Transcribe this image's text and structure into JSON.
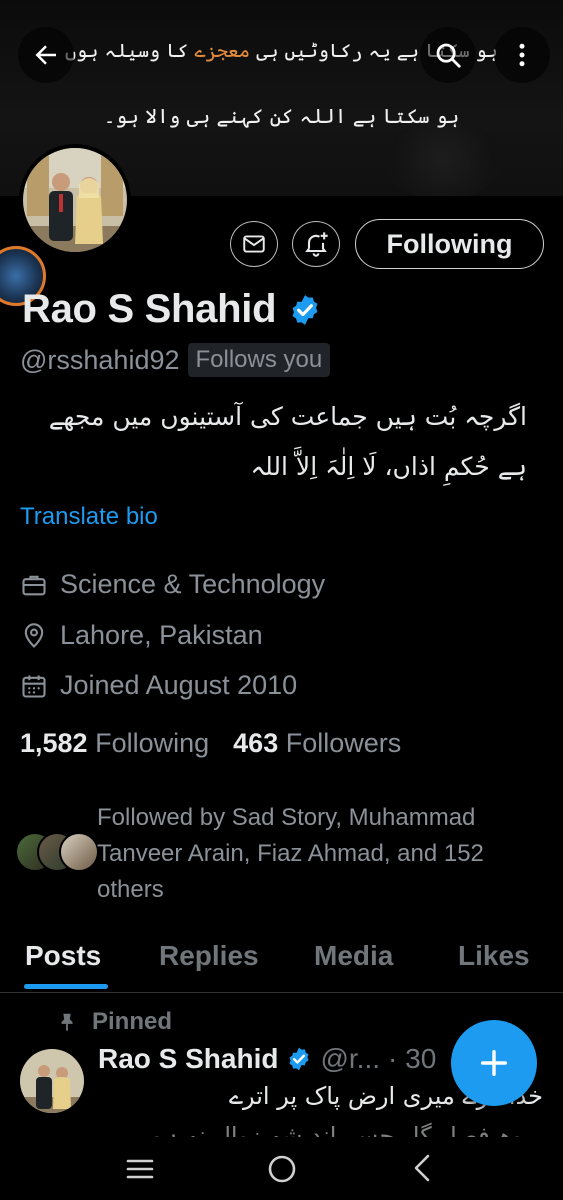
{
  "banner": {
    "line1_part1": "ہو سکتا ہے یہ رکاوٹیں ہی",
    "line1_highlight": "معجزے",
    "line1_part2": "کا وسیلہ ہوں",
    "line2": "ہو سکتا ہے اللہ کن کہنے ہی والا ہو۔"
  },
  "icons": {
    "back": "arrow-left-icon",
    "search": "search-icon",
    "more": "more-vertical-icon",
    "message": "envelope-icon",
    "notify": "bell-plus-icon",
    "verified": "verified-badge-icon",
    "category": "briefcase-icon",
    "location": "location-pin-icon",
    "joined": "calendar-icon",
    "pin": "pin-icon",
    "compose": "plus-icon"
  },
  "colors": {
    "accent": "#1d9bf0",
    "banner_highlight": "#e08a3c",
    "background": "#000000",
    "muted_text": "#8b9198"
  },
  "profile": {
    "follow_button": "Following",
    "name": "Rao S Shahid",
    "handle": "@rsshahid92",
    "follows_you": "Follows you",
    "bio_line1": "اگرچہ بُت ہیں جماعت کی آستینوں میں مجھے",
    "bio_line2": "ہے حُکمِ اذاں، لَا اِلٰہَ اِلاَّ اللہ",
    "translate_bio": "Translate bio",
    "category": "Science & Technology",
    "location": "Lahore, Pakistan",
    "joined": "Joined August 2010",
    "following_count": "1,582",
    "following_label": "Following",
    "followers_count": "463",
    "followers_label": "Followers",
    "followed_by": "Followed by Sad Story, Muhammad Tanveer Arain, Fiaz Ahmad, and 152 others"
  },
  "tabs": [
    "Posts",
    "Replies",
    "Media",
    "Likes"
  ],
  "active_tab": "Posts",
  "pinned_post": {
    "pinned_label": "Pinned",
    "author": "Rao S Shahid",
    "handle": "@r...",
    "time": "· 30",
    "text_line1": "خدا کرے میری ارض پاک پر اترے",
    "text_line2": "وہ فصل گل جسے اندیشہ زوال نہ ہو"
  },
  "system_nav": {
    "recents": "recents-icon",
    "home": "home-circle-icon",
    "back": "back-chevron-icon"
  }
}
